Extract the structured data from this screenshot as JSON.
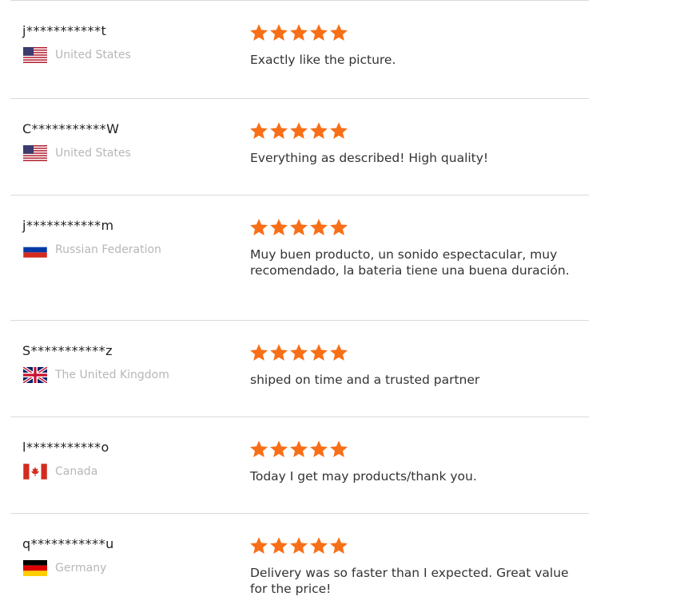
{
  "reviews": [
    {
      "user": "j***********t",
      "country": "United States",
      "flag": "us-flag-icon",
      "stars": 5,
      "text": "Exactly like the picture."
    },
    {
      "user": "C***********W",
      "country": "United States",
      "flag": "us-flag-icon",
      "stars": 5,
      "text": "Everything as described! High quality!"
    },
    {
      "user": "j***********m",
      "country": "Russian Federation",
      "flag": "ru-flag-icon",
      "stars": 5,
      "text": "Muy buen producto, un sonido espectacular, muy recomendado, la bateria tiene una buena duración."
    },
    {
      "user": "S***********z",
      "country": "The United Kingdom",
      "flag": "gb-flag-icon",
      "stars": 5,
      "text": "shiped on time and a trusted partner"
    },
    {
      "user": "l***********o",
      "country": "Canada",
      "flag": "ca-flag-icon",
      "stars": 5,
      "text": "Today I get may products/thank you."
    },
    {
      "user": "q***********u",
      "country": "Germany",
      "flag": "de-flag-icon",
      "stars": 5,
      "text": "Delivery was so faster than I expected. Great value for the price!"
    }
  ],
  "colors": {
    "star": "#f86f18",
    "divider": "#d9d9d9",
    "country_text": "#b7b7b7"
  }
}
